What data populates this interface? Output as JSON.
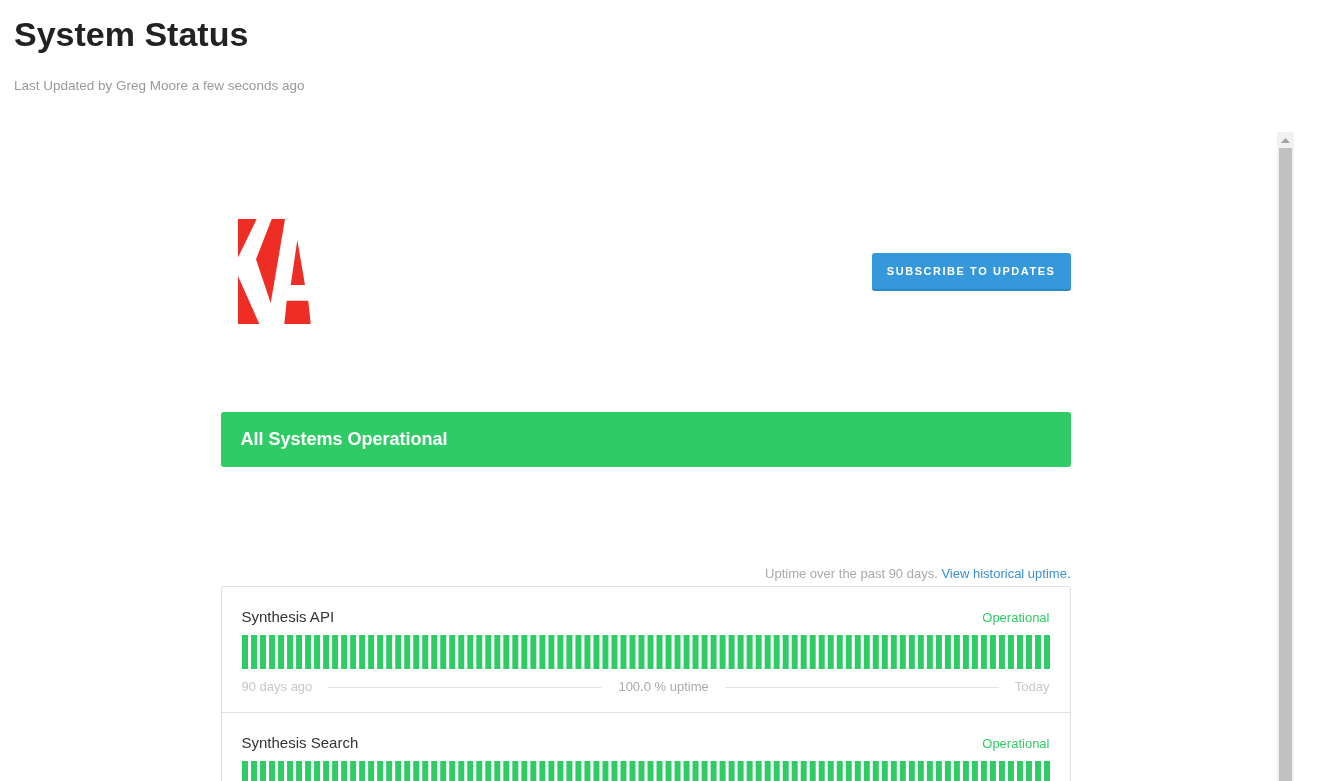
{
  "page": {
    "title": "System Status",
    "last_updated": "Last Updated by Greg Moore a few seconds ago"
  },
  "status_page": {
    "subscribe_button": "SUBSCRIBE TO UPDATES",
    "banner": {
      "text": "All Systems Operational",
      "operational": true
    },
    "uptime_caption": {
      "text": "Uptime over the past 90 days.",
      "link": "View historical uptime."
    },
    "components": [
      {
        "name": "Synthesis API",
        "status": "Operational",
        "operational": true,
        "range_start": "90 days ago",
        "uptime": "100.0 % uptime",
        "range_end": "Today"
      },
      {
        "name": "Synthesis Search",
        "status": "Operational",
        "operational": true
      }
    ]
  }
}
